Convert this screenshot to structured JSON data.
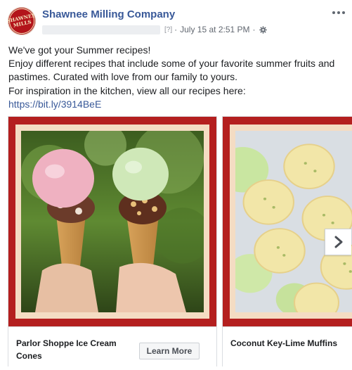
{
  "post": {
    "page_name": "Shawnee Milling Company",
    "avatar_text": "SHAWNEE MILLS",
    "meta_unknown": "[?]",
    "timestamp": "July 15 at 2:51 PM",
    "separator": "·",
    "privacy_icon": "gear-icon",
    "text_lines": [
      "We've got your Summer recipes!",
      "Enjoy different recipes that include some of your favorite summer fruits and pastimes. Curated with love from our family to yours.",
      "For inspiration in the kitchen, view all our recipes here:"
    ],
    "link": "https://bit.ly/3914BeE"
  },
  "carousel": {
    "cards": [
      {
        "title": "Parlor Shoppe Ice Cream Cones",
        "cta": "Learn More",
        "image": "ice-cream-cones-photo"
      },
      {
        "title": "Coconut Key-Lime Muffins",
        "image": "key-lime-muffins-photo"
      }
    ],
    "next_icon": "chevron-right-icon"
  },
  "colors": {
    "brand_link": "#385898",
    "frame_red": "#b41f1f",
    "mat_cream": "#f4dcc3"
  }
}
